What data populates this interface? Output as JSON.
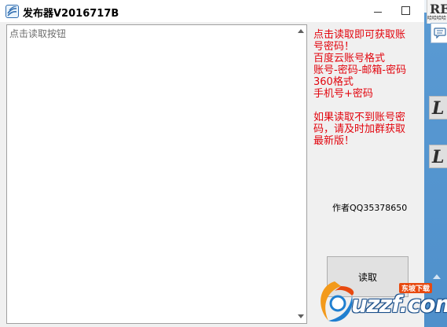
{
  "window": {
    "title": "发布器V2016717B"
  },
  "textarea": {
    "placeholder": "点击读取按钮"
  },
  "notice": {
    "lines": [
      "点击读取即可获取账",
      "号密码！",
      "百度云账号格式",
      "账号-密码-邮箱-密码",
      "360格式",
      "手机号+密码",
      "",
      "如果读取不到账号密",
      "码，请及时加群获取",
      "最新版！"
    ]
  },
  "author": "作者QQ35378650",
  "read_button": {
    "label": "读取"
  },
  "desktop": {
    "glyph_top": "RE",
    "glyph_small": "哈哈哈哈",
    "tile_letter": "L"
  },
  "watermark": {
    "brand": "uzzf.com",
    "tag": "东坡下载"
  },
  "colors": {
    "notice_text": "#e2050e",
    "desktop_blue": "#4a8bc6"
  }
}
